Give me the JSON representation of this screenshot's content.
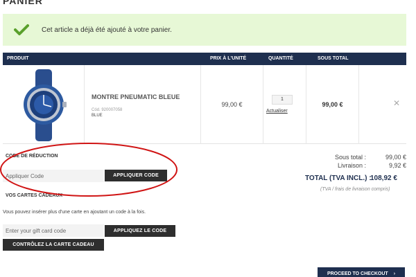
{
  "page": {
    "title": "PANIER"
  },
  "notice": {
    "message": "Cet article a déjà été ajouté à votre panier.",
    "icon": "check-icon",
    "color": "#e7f8d6",
    "icon_color": "#5aa02c"
  },
  "cart": {
    "headers": {
      "product": "PRODUIT",
      "unit_price": "PRIX À L'UNITÉ",
      "quantity": "QUANTITÉ",
      "subtotal": "SOUS TOTAL"
    },
    "items": [
      {
        "name": "MONTRE PNEUMATIC BLEUE",
        "ref": "Cód. 920007058",
        "color": "BLUE",
        "unit_price": "99,00 €",
        "quantity": "1",
        "update_label": "Actualiser",
        "subtotal": "99,00 €",
        "remove_icon": "close-icon"
      }
    ]
  },
  "discount": {
    "title": "CODE DE RÉDUCTION",
    "placeholder": "Appliquer Code",
    "button": "APPLIQUER CODE"
  },
  "gift": {
    "title": "VOS CARTES CADEAUX",
    "info": "Vous pouvez insérer plus d'une carte en ajoutant un code à la fois.",
    "placeholder": "Enter your gift card code",
    "apply_button": "APPLIQUEZ LE CODE",
    "check_button": "CONTRÔLEZ LA CARTE CADEAU"
  },
  "totals": {
    "subtotal_label": "Sous total :",
    "subtotal_value": "99,00 €",
    "shipping_label": "Livraison :",
    "shipping_value": "9,92 €",
    "total_label": "TOTAL (TVA INCL.) :",
    "total_value": "108,92 €",
    "vat_note": "(TVA / frais de livraison compris)"
  },
  "checkout": {
    "label": "PROCEED TO CHECKOUT",
    "icon": "chevron-right-icon"
  },
  "colors": {
    "navy": "#1e2f4f",
    "dark_button": "#2e2e2e",
    "annotation": "#d01414"
  }
}
